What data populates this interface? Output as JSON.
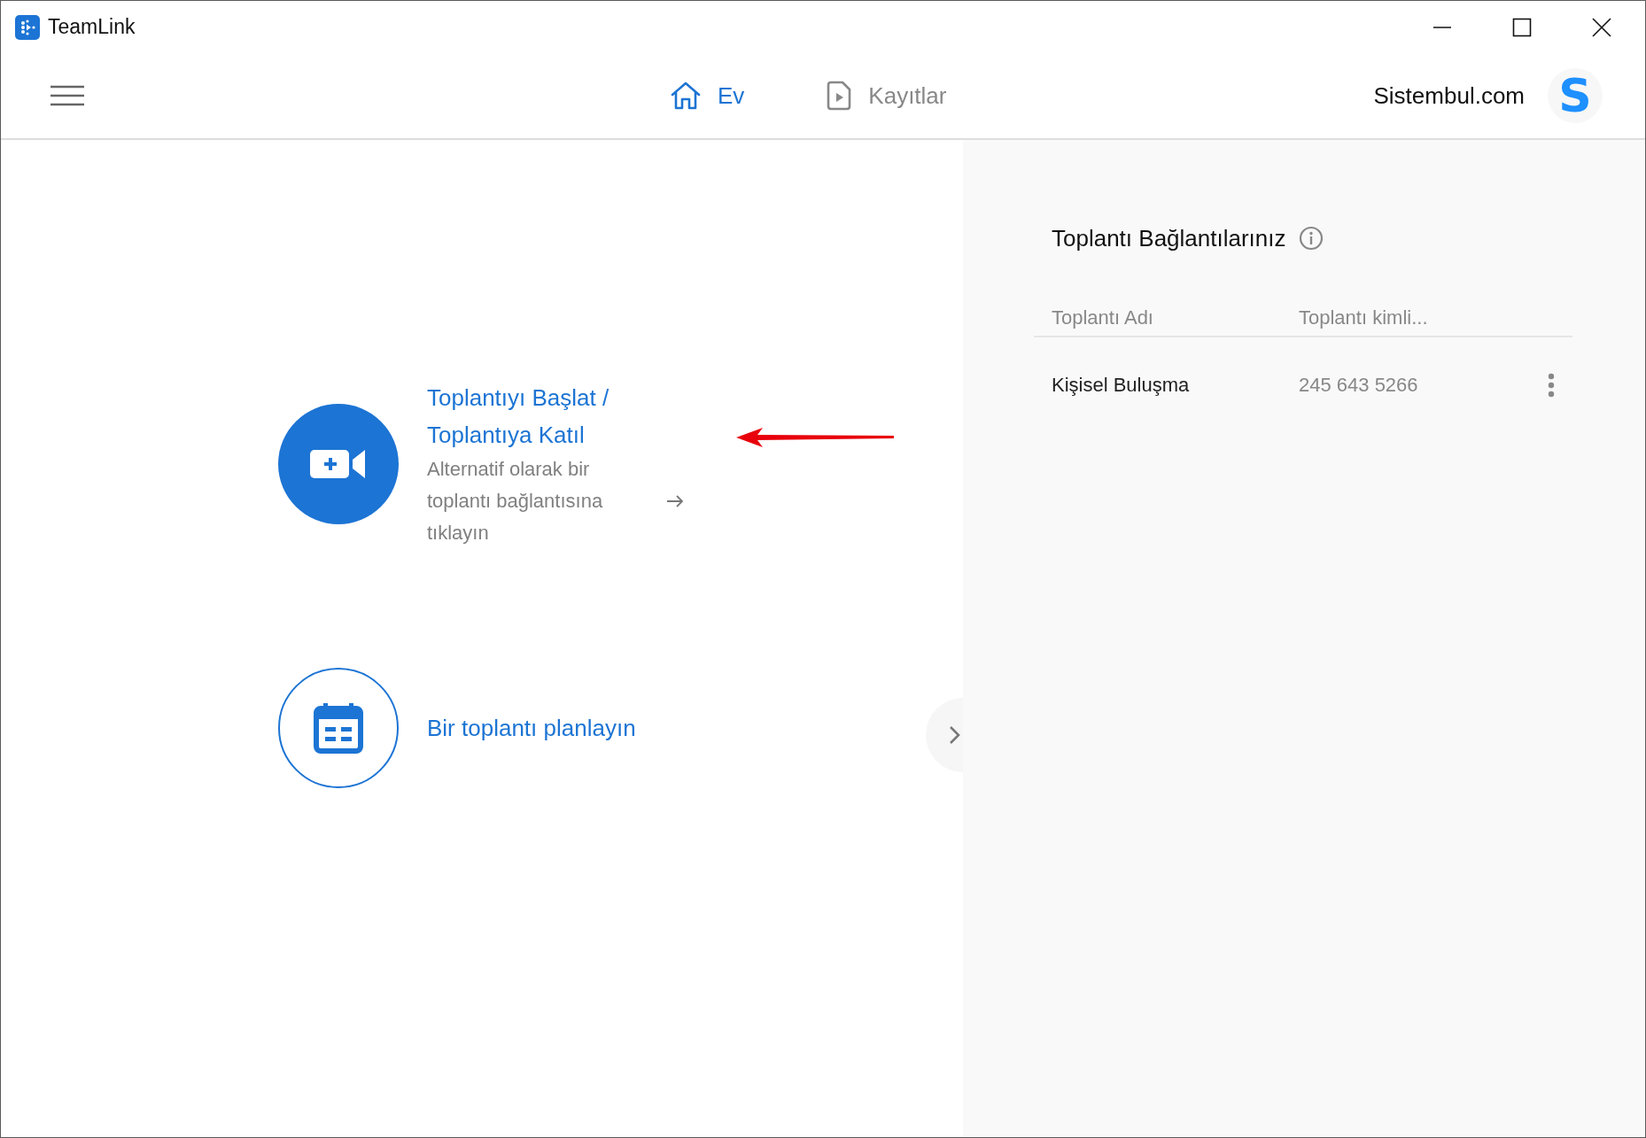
{
  "window": {
    "title": "TeamLink"
  },
  "nav": {
    "tabs": [
      {
        "label": "Ev",
        "kind": "home",
        "selected": true
      },
      {
        "label": "Kayıtlar",
        "kind": "recordings",
        "selected": false
      }
    ],
    "account": "Sistembul.com",
    "avatar_letter": "S"
  },
  "actions": [
    {
      "kind": "filled",
      "title": "Toplantıyı Başlat / Toplantıya Katıl",
      "subtitle": "Alternatif olarak bir toplantı bağlantısına tıklayın"
    },
    {
      "kind": "outline",
      "title": "Bir toplantı planlayın"
    }
  ],
  "links_panel": {
    "title": "Toplantı Bağlantılarınız",
    "columns": [
      "Toplantı Adı",
      "Toplantı kimli..."
    ],
    "rows": [
      {
        "name": "Kişisel Buluşma",
        "id": "245 643 5266"
      }
    ]
  }
}
